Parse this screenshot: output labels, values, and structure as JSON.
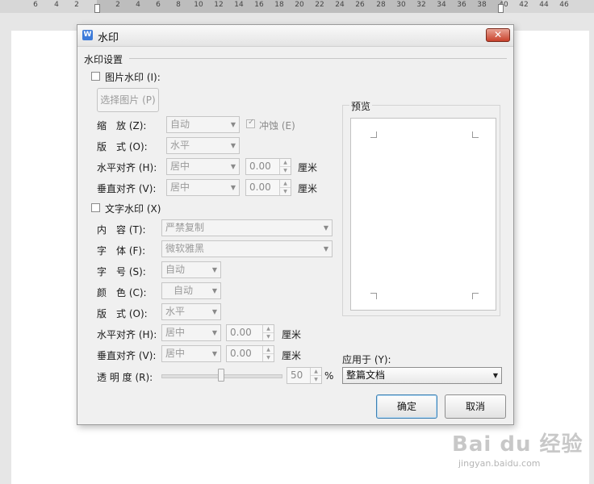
{
  "ruler": {
    "numbers": [
      "6",
      "4",
      "2",
      "2",
      "4",
      "6",
      "8",
      "10",
      "12",
      "14",
      "16",
      "18",
      "20",
      "22",
      "24",
      "26",
      "28",
      "30",
      "32",
      "34",
      "36",
      "38",
      "40",
      "42",
      "44",
      "46"
    ]
  },
  "dialog": {
    "title": "水印",
    "close_label": "✕",
    "section_title": "水印设置",
    "picture": {
      "checkbox_label": "图片水印 (I):",
      "select_button": "选择图片 (P)",
      "scale_label": "缩　放 (Z):",
      "scale_value": "自动",
      "washout_label": "冲蚀 (E)",
      "layout_label": "版　式 (O):",
      "layout_value": "水平",
      "halign_label": "水平对齐 (H):",
      "halign_value": "居中",
      "halign_offset": "0.00",
      "valign_label": "垂直对齐 (V):",
      "valign_value": "居中",
      "valign_offset": "0.00",
      "unit": "厘米"
    },
    "text": {
      "checkbox_label": "文字水印 (X)",
      "content_label": "内　容 (T):",
      "content_value": "严禁复制",
      "font_label": "字　体 (F):",
      "font_value": "微软雅黑",
      "size_label": "字　号 (S):",
      "size_value": "自动",
      "color_label": "颜　色 (C):",
      "color_value": "自动",
      "layout_label": "版　式 (O):",
      "layout_value": "水平",
      "halign_label": "水平对齐 (H):",
      "halign_value": "居中",
      "halign_offset": "0.00",
      "valign_label": "垂直对齐 (V):",
      "valign_value": "居中",
      "valign_offset": "0.00",
      "unit": "厘米",
      "transparency_label": "透 明 度 (R):",
      "transparency_value": "50",
      "transparency_unit": "%"
    },
    "preview_label": "预览",
    "apply_label": "应用于 (Y):",
    "apply_value": "整篇文档",
    "ok_button": "确定",
    "cancel_button": "取消"
  },
  "watermark": {
    "brand": "Bai du 经验",
    "url": "jingyan.baidu.com"
  }
}
